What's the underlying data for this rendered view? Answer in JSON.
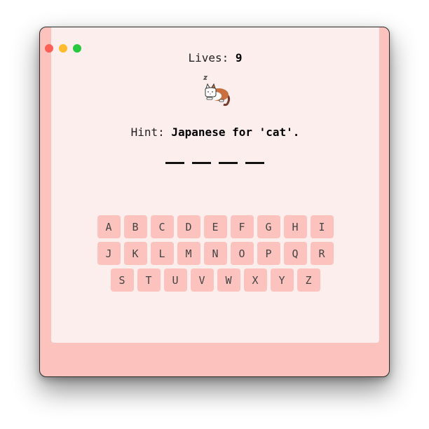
{
  "window": {
    "controls": [
      "close",
      "minimize",
      "zoom"
    ]
  },
  "game": {
    "lives_label": "Lives:",
    "lives_value": "9",
    "hint_label": "Hint:",
    "hint_value": "Japanese for 'cat'.",
    "word_length": 4
  },
  "keyboard": {
    "rows": [
      [
        "A",
        "B",
        "C",
        "D",
        "E",
        "F",
        "G",
        "H",
        "I"
      ],
      [
        "J",
        "K",
        "L",
        "M",
        "N",
        "O",
        "P",
        "Q",
        "R"
      ],
      [
        "S",
        "T",
        "U",
        "V",
        "W",
        "X",
        "Y",
        "Z"
      ]
    ]
  },
  "colors": {
    "frame": "#fcc3be",
    "panel": "#fdeeee",
    "key": "#fcc3be",
    "close": "#fe5f57",
    "minimize": "#febc2e",
    "zoom": "#28c840"
  },
  "icons": {
    "mascot": "sleeping-cat-icon"
  }
}
